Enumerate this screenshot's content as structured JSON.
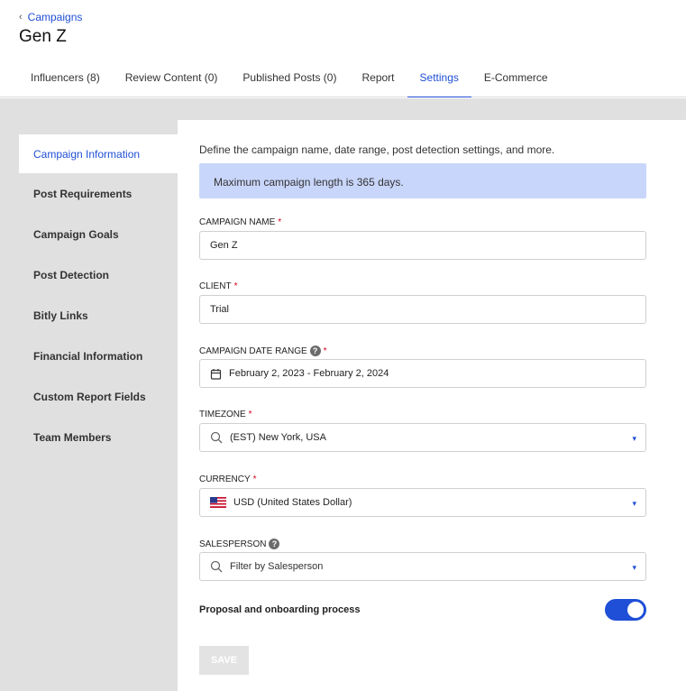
{
  "breadcrumb": {
    "back_label": "Campaigns"
  },
  "page": {
    "title": "Gen Z"
  },
  "tabs": [
    {
      "label": "Influencers (8)"
    },
    {
      "label": "Review Content (0)"
    },
    {
      "label": "Published Posts (0)"
    },
    {
      "label": "Report"
    },
    {
      "label": "Settings",
      "active": true
    },
    {
      "label": "E-Commerce"
    }
  ],
  "sidebar": {
    "items": [
      {
        "label": "Campaign Information",
        "active": true
      },
      {
        "label": "Post Requirements"
      },
      {
        "label": "Campaign Goals"
      },
      {
        "label": "Post Detection"
      },
      {
        "label": "Bitly Links"
      },
      {
        "label": "Financial Information"
      },
      {
        "label": "Custom Report Fields"
      },
      {
        "label": "Team Members"
      }
    ]
  },
  "form": {
    "intro": "Define the campaign name, date range, post detection settings, and more.",
    "notice": "Maximum campaign length is 365 days.",
    "campaign_name": {
      "label": "Campaign Name",
      "value": "Gen Z"
    },
    "client": {
      "label": "Client",
      "value": "Trial"
    },
    "date_range": {
      "label": "Campaign Date Range",
      "value": "February 2, 2023 - February 2, 2024"
    },
    "timezone": {
      "label": "Timezone",
      "value": "(EST) New York, USA"
    },
    "currency": {
      "label": "Currency",
      "value": "USD (United States Dollar)"
    },
    "salesperson": {
      "label": "Salesperson",
      "placeholder": "Filter by Salesperson"
    },
    "proposal_toggle": {
      "label": "Proposal and onboarding process",
      "on": true
    },
    "required_mark": "*",
    "help_mark": "?",
    "save_label": "SAVE"
  },
  "colors": {
    "accent": "#1f4fd6",
    "notice_bg": "#c9d6fb",
    "required": "#d0021b"
  }
}
